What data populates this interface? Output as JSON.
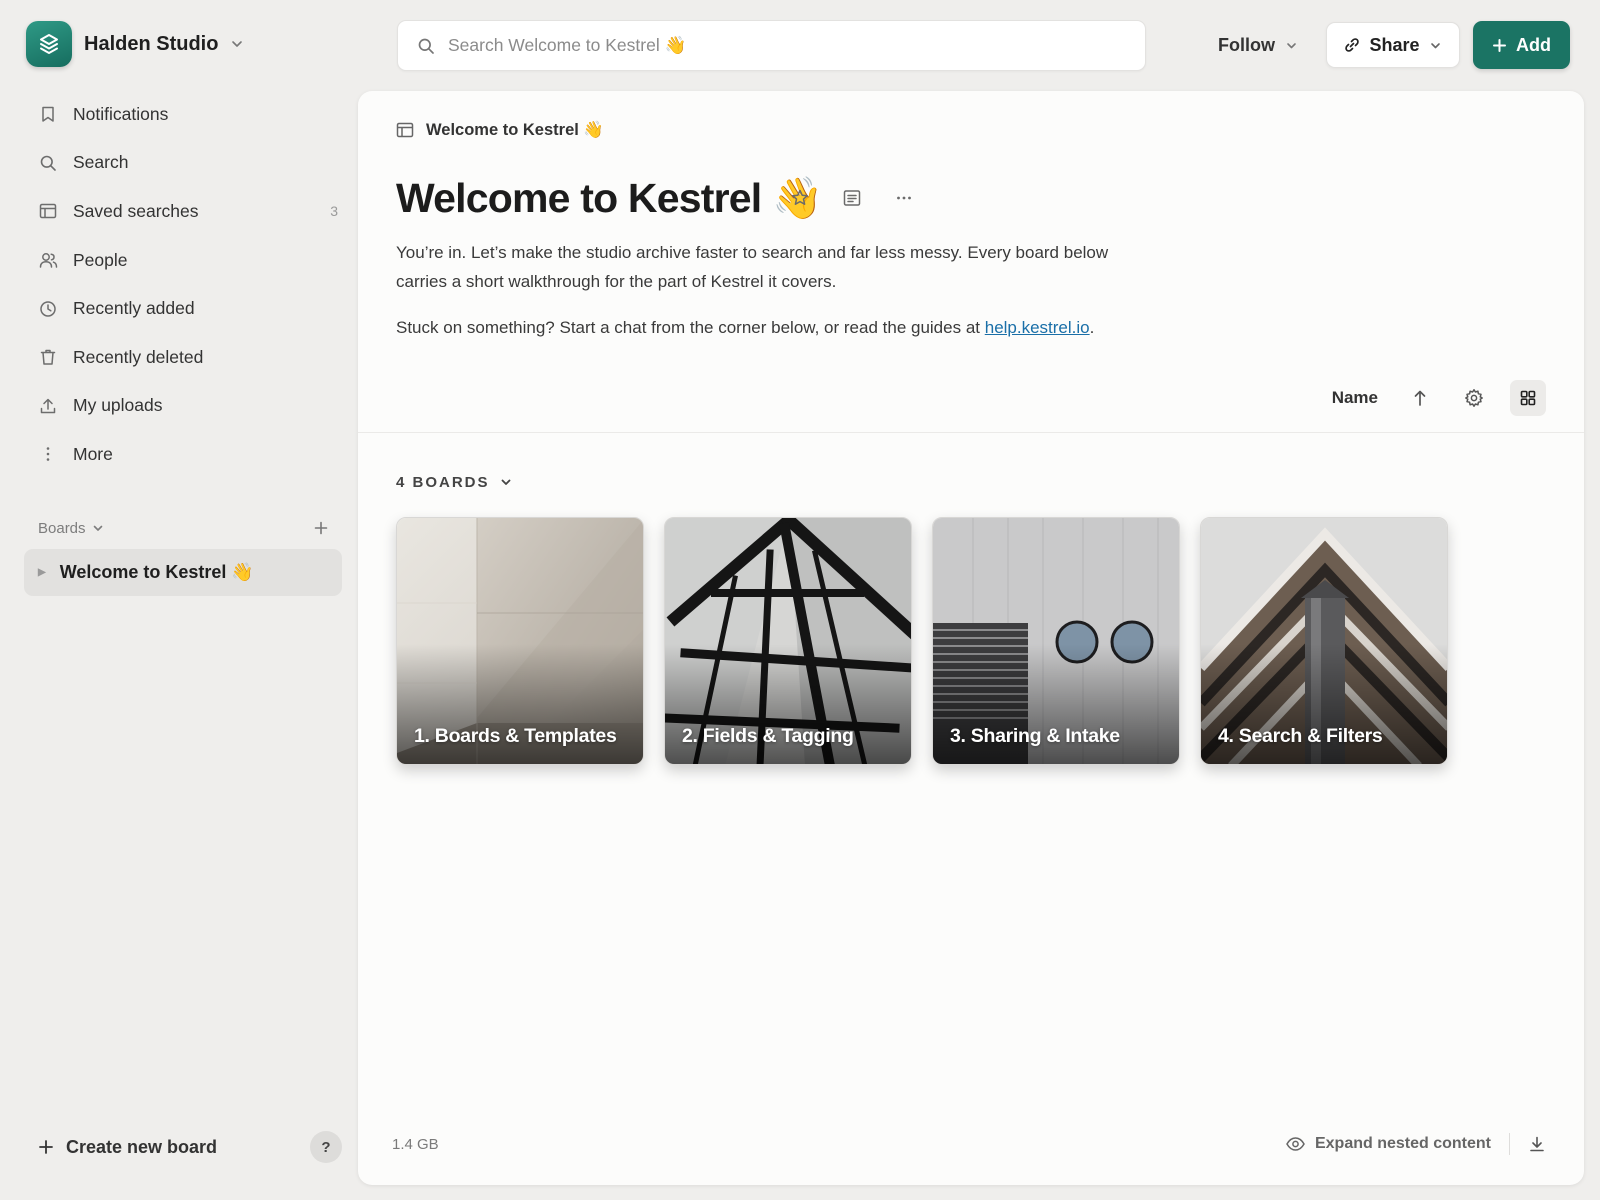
{
  "workspace": {
    "name": "Halden Studio"
  },
  "nav": [
    {
      "label": "Notifications",
      "icon": "bookmark-icon"
    },
    {
      "label": "Search",
      "icon": "search-icon"
    },
    {
      "label": "Saved searches",
      "icon": "saved-search-icon",
      "count": "3"
    },
    {
      "label": "People",
      "icon": "people-icon"
    },
    {
      "label": "Recently added",
      "icon": "clock-icon"
    },
    {
      "label": "Recently deleted",
      "icon": "trash-icon"
    },
    {
      "label": "My uploads",
      "icon": "upload-icon"
    },
    {
      "label": "More",
      "icon": "more-vertical-icon"
    }
  ],
  "boards_section": {
    "label": "Boards",
    "items": [
      {
        "label": "Welcome to Kestrel 👋"
      }
    ]
  },
  "create_board": "Create new board",
  "help": "?",
  "topbar": {
    "search_placeholder": "Search Welcome to Kestrel 👋",
    "follow": "Follow",
    "share": "Share",
    "add": "Add"
  },
  "page": {
    "breadcrumb": "Welcome to Kestrel 👋",
    "title": "Welcome to Kestrel 👋",
    "desc1": "You’re in. Let’s make the studio archive faster to search and far less messy. Every board below carries a short walkthrough for the part of Kestrel it covers.",
    "desc2_text": "Stuck on something? Start a chat from the corner below, or read the guides at",
    "desc2_link": "help.kestrel.io",
    "desc2_end": ".",
    "sort_label": "Name",
    "count_label": "4 BOARDS",
    "storage": "1.4 GB",
    "expand": "Expand nested content"
  },
  "cards": [
    {
      "label": "1. Boards & Templates",
      "art": "concrete-wall-photo"
    },
    {
      "label": "2. Fields & Tagging",
      "art": "glass-facade-photo"
    },
    {
      "label": "3. Sharing & Intake",
      "art": "round-windows-photo"
    },
    {
      "label": "4. Search & Filters",
      "art": "chevron-building-photo"
    }
  ],
  "colors": {
    "accent": "#1b7464",
    "background": "#efeeec",
    "panel": "#fcfcfb",
    "link": "#1a6fa8"
  }
}
